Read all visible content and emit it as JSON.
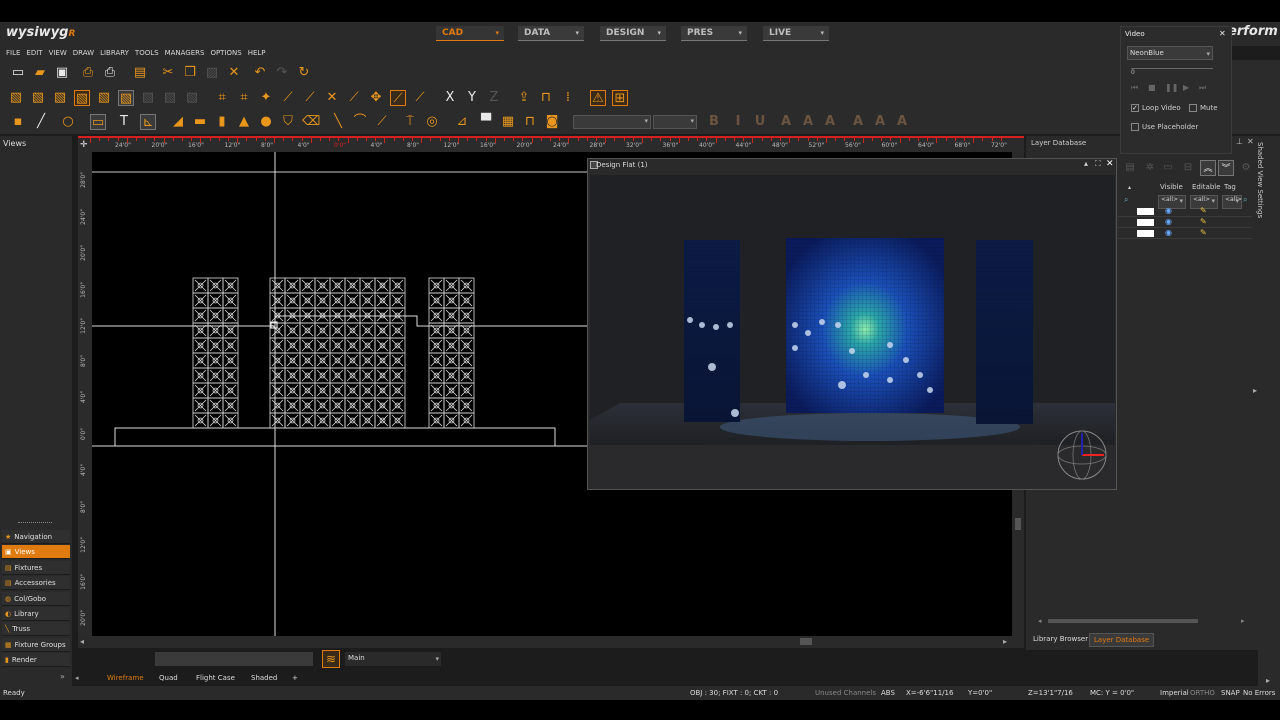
{
  "app": {
    "logo": "wysiwyg",
    "logo_tag": "R",
    "brand_fragment": "erform"
  },
  "modes": [
    {
      "label": "CAD",
      "active": true
    },
    {
      "label": "DATA",
      "active": false
    },
    {
      "label": "DESIGN",
      "active": false
    },
    {
      "label": "PRES",
      "active": false
    },
    {
      "label": "LIVE",
      "active": false
    }
  ],
  "menu": [
    "FILE",
    "EDIT",
    "VIEW",
    "DRAW",
    "LIBRARY",
    "TOOLS",
    "MANAGERS",
    "OPTIONS",
    "HELP"
  ],
  "video_panel": {
    "title": "Video",
    "selected_video": "NeonBlue",
    "position": "0",
    "loop_label": "Loop Video",
    "loop_checked": true,
    "mute_label": "Mute",
    "mute_checked": false,
    "placeholder_label": "Use Placeholder",
    "placeholder_checked": false
  },
  "views_panel": {
    "title": "Views"
  },
  "nav_items": [
    {
      "label": "Navigation",
      "icon": "★",
      "active": false
    },
    {
      "label": "Views",
      "icon": "▣",
      "active": true
    },
    {
      "label": "Fixtures",
      "icon": "▤",
      "active": false
    },
    {
      "label": "Accessories",
      "icon": "▤",
      "active": false
    },
    {
      "label": "Col/Gobo",
      "icon": "◍",
      "active": false
    },
    {
      "label": "Library",
      "icon": "◐",
      "active": false
    },
    {
      "label": "Truss",
      "icon": "╲",
      "active": false
    },
    {
      "label": "Fixture Groups",
      "icon": "▦",
      "active": false
    },
    {
      "label": "Render",
      "icon": "▮",
      "active": false
    }
  ],
  "ruler_top": [
    "24'0\"",
    "20'0\"",
    "16'0\"",
    "12'0\"",
    "8'0\"",
    "4'0\"",
    "0'0\"",
    "4'0\"",
    "8'0\"",
    "12'0\"",
    "16'0\"",
    "20'0\"",
    "24'0\"",
    "28'0\"",
    "32'0\"",
    "36'0\"",
    "40'0\"",
    "44'0\"",
    "48'0\"",
    "52'0\"",
    "56'0\"",
    "60'0\"",
    "64'0\"",
    "68'0\"",
    "72'0\""
  ],
  "ruler_left": [
    "28'0\"",
    "24'0\"",
    "20'0\"",
    "16'0\"",
    "12'0\"",
    "8'0\"",
    "4'0\"",
    "0'0\"",
    "4'0\"",
    "8'0\"",
    "12'0\"",
    "16'0\"",
    "20'0\""
  ],
  "design_flat": {
    "title": "Design Flat (1)"
  },
  "layer_database": {
    "title": "Layer Database",
    "columns": [
      "Visible",
      "Editable",
      "Tag"
    ],
    "filter": "<all>",
    "rows": 3,
    "tabs": [
      {
        "label": "Library Browser",
        "active": false
      },
      {
        "label": "Layer Database",
        "active": true
      }
    ]
  },
  "shaded_side_label": "Shaded View Settings",
  "layer_bar": {
    "layer_name": "Main"
  },
  "view_tabs": [
    {
      "label": "Wireframe",
      "active": true
    },
    {
      "label": "Quad",
      "active": false
    },
    {
      "label": "Flight Case",
      "active": false
    },
    {
      "label": "Shaded",
      "active": false
    },
    {
      "label": "+",
      "active": false
    }
  ],
  "status": {
    "ready": "Ready",
    "counts": "OBJ : 30; FIXT : 0; CKT : 0",
    "unused": "Unused Channels",
    "abs": "ABS",
    "x": "X=-6'6\"11/16",
    "y": "Y=0'0\"",
    "z": "Z=13'1\"7/16",
    "mc": "MC: Y = 0'0\"",
    "units": "Imperial",
    "ortho": "ORTHO",
    "snap": "SNAP",
    "errors": "No Errors"
  },
  "colors": {
    "accent": "#e07b10",
    "ruler_red": "#d71f1f",
    "panel": "#2a2a2a"
  }
}
